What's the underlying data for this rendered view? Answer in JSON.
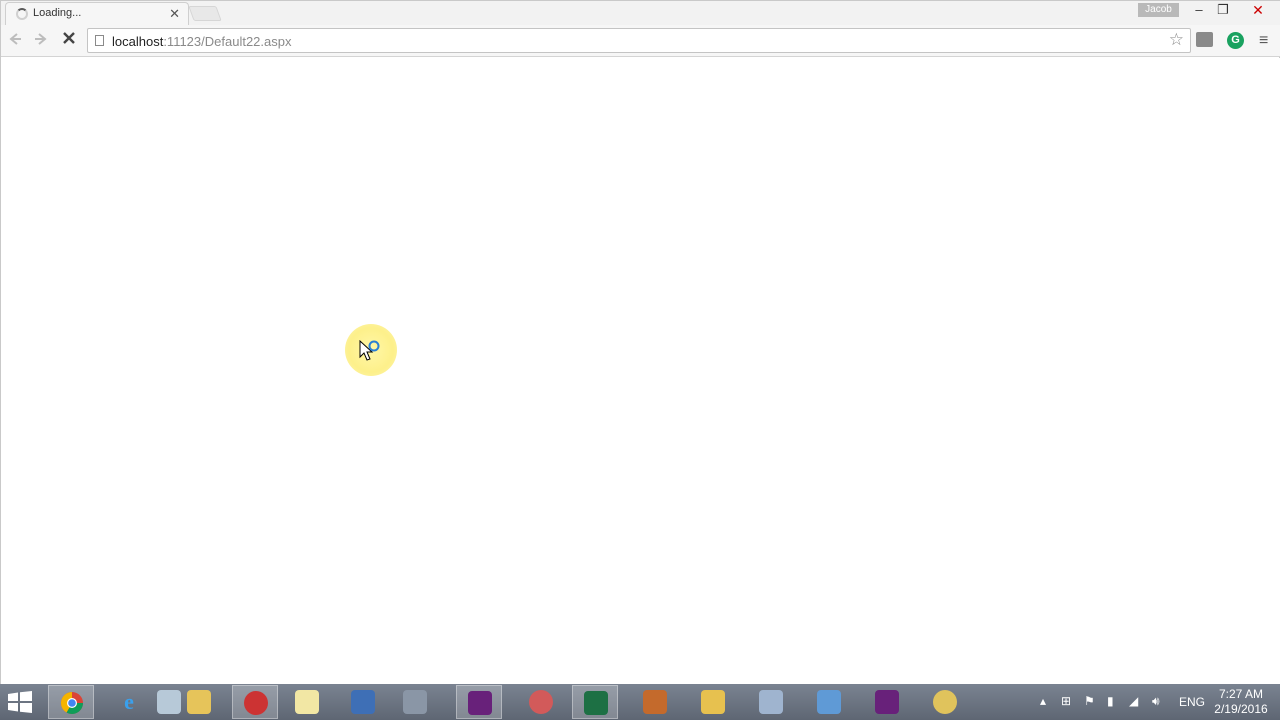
{
  "browser": {
    "tab": {
      "title": "Loading...",
      "close_glyph": "✕"
    },
    "profile_name": "Jacob",
    "window_controls": {
      "minimize": "–",
      "restore": "❐",
      "close": "✕"
    },
    "url": {
      "host": "localhost",
      "path": ":11123/Default22.aspx"
    },
    "icons": {
      "back": "back-arrow-icon",
      "forward": "forward-arrow-icon",
      "stop": "stop-x-icon",
      "bookmark": "star-icon",
      "menu": "hamburger-menu-icon"
    },
    "extension_grammarly_letter": "G"
  },
  "taskbar": {
    "apps": [
      "chrome",
      "internet-explorer",
      "paint",
      "file-explorer",
      "media-tool",
      "notepad",
      "remote-desktop",
      "tools",
      "visual-studio",
      "snipping-tool",
      "excel",
      "bridge-app",
      "calculator",
      "file-manager",
      "visual-studio-2",
      "paint-2"
    ],
    "tray": {
      "language": "ENG"
    },
    "clock": {
      "time": "7:27 AM",
      "date": "2/19/2016"
    }
  },
  "colors": {
    "accent_chrome_green": "#1aa260",
    "visual_studio_purple": "#68217a",
    "excel_green": "#1d7044",
    "taskbar": "#6b7380"
  }
}
